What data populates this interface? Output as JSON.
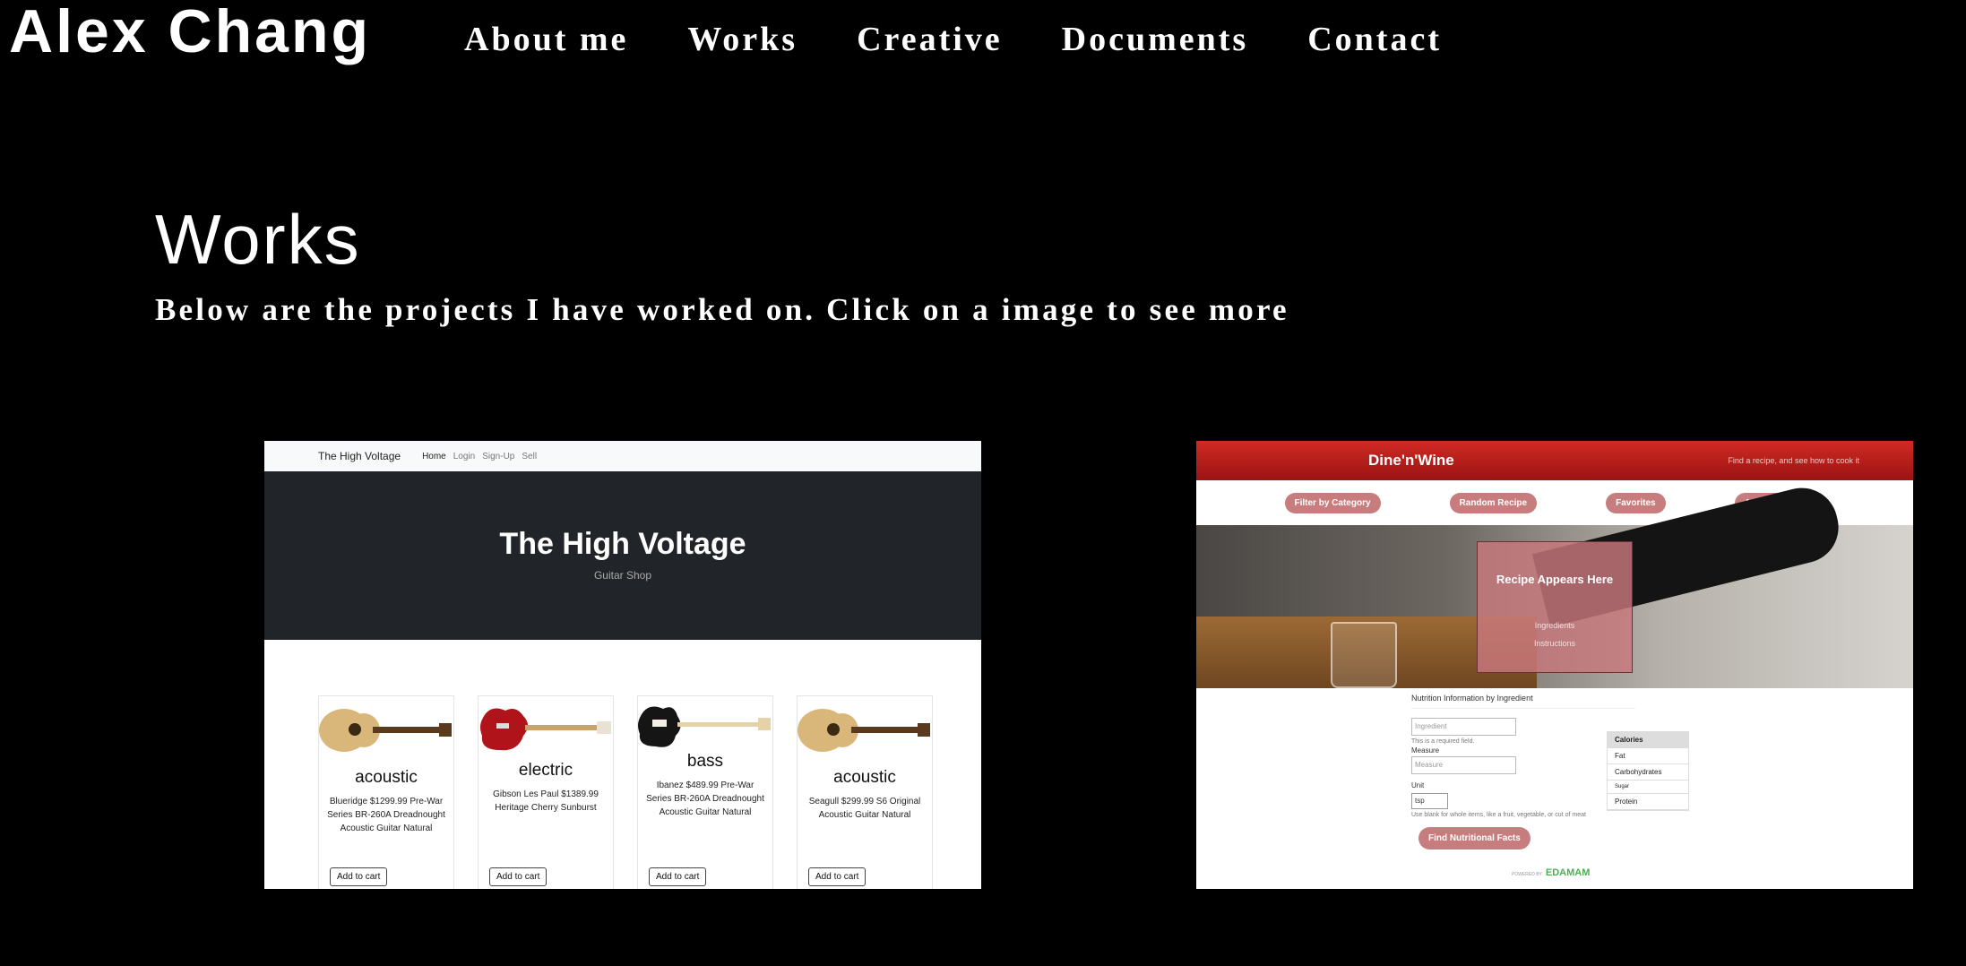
{
  "brand": "Alex Chang",
  "nav": [
    "About me",
    "Works",
    "Creative",
    "Documents",
    "Contact"
  ],
  "page": {
    "title": "Works",
    "subtitle": "Below are the projects I have worked on. Click on a image to see more"
  },
  "project1": {
    "nav_brand": "The High Voltage",
    "nav_links": [
      "Home",
      "Login",
      "Sign-Up",
      "Sell"
    ],
    "hero_title": "The High Voltage",
    "hero_subtitle": "Guitar Shop",
    "products": [
      {
        "name": "acoustic",
        "desc": "Blueridge $1299.99 Pre-War Series BR-260A Dreadnought Acoustic Guitar Natural",
        "button": "Add to cart",
        "body_color": "#d9b77b"
      },
      {
        "name": "electric",
        "desc": "Gibson Les Paul $1389.99 Heritage Cherry Sunburst",
        "button": "Add to cart",
        "body_color": "#b0141a"
      },
      {
        "name": "bass",
        "desc": "Ibanez $489.99 Pre-War Series BR-260A Dreadnought Acoustic Guitar Natural",
        "button": "Add to cart",
        "body_color": "#151515"
      },
      {
        "name": "acoustic",
        "desc": "Seagull $299.99 S6 Original Acoustic Guitar Natural",
        "button": "Add to cart",
        "body_color": "#d9b77b"
      }
    ]
  },
  "project2": {
    "brand": "Dine'n'Wine",
    "tagline": "Find a recipe, and see how to cook it",
    "buttons": [
      "Filter by Category",
      "Random Recipe",
      "Favorites",
      "Add to Favorites"
    ],
    "recipe_title": "Recipe Appears Here",
    "recipe_items": [
      "Ingredients",
      "Instructions"
    ],
    "form_header": "Nutrition Information by Ingredient",
    "ingredient_placeholder": "Ingredient",
    "required_note": "This is a required field.",
    "measure_label": "Measure",
    "measure_placeholder": "Measure",
    "unit_label": "Unit",
    "unit_value": "tsp",
    "unit_note": "Use blank for whole items, like a fruit, vegetable, or cut of meat",
    "submit_label": "Find Nutritional Facts",
    "nutrients": [
      "Calories",
      "Fat",
      "Carbohydrates",
      "Sugar",
      "Protein"
    ],
    "powered_prefix": "POWERED BY",
    "powered_brand": "EDAMAM"
  }
}
